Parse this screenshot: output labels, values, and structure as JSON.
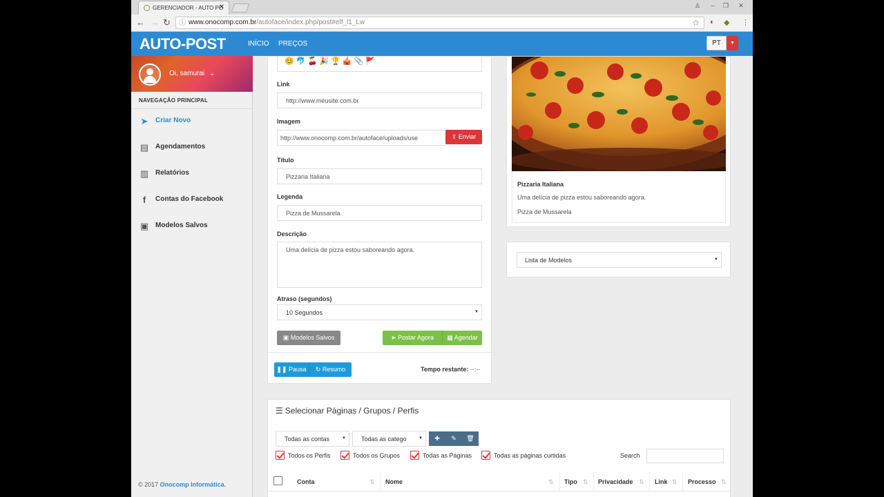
{
  "browser": {
    "tab_title": "GERENCIADOR - AUTO PO",
    "url_host": "www.onocomp.com.br",
    "url_path": "/autoface/index.php/post#elf_l1_Lw"
  },
  "app": {
    "brand": "AUTO-POST",
    "nav_links": [
      "INÍCIO",
      "PREÇOS"
    ],
    "language": "PT",
    "accent_color": "#2d8ad2",
    "danger_color": "#d9373b"
  },
  "sidebar": {
    "greeting": "Oi, samurai",
    "section_title": "NAVEGAÇÃO PRINCIPAL",
    "items": [
      {
        "label": "Criar Novo",
        "icon": "send-icon"
      },
      {
        "label": "Agendamentos",
        "icon": "clipboard-icon"
      },
      {
        "label": "Relatórios",
        "icon": "bar-chart-icon"
      },
      {
        "label": "Contas do Facebook",
        "icon": "facebook-icon"
      },
      {
        "label": "Modelos Salvos",
        "icon": "floppy-icon"
      }
    ],
    "copyright_prefix": "© 2017",
    "copyright_company": "Onocomp Informática."
  },
  "form": {
    "emoji_row": "😊 🐬 🍒 🎉 🏆 🎪 📎 🚩",
    "link_label": "Link",
    "link_placeholder": "http://www.meusite.com.br",
    "image_label": "Imagem",
    "image_value": "http://www.onocomp.com.br/autoface/uploads/use",
    "upload_button": "Enviar",
    "title_label": "Título",
    "title_value": "Pizzaria Italiana",
    "caption_label": "Legenda",
    "caption_value": "Pizza de Mussarela",
    "desc_label": "Descrição",
    "desc_value": "Uma delícia de pizza estou saboreando agora.",
    "delay_label": "Atraso (segundos)",
    "delay_value": "10 Segundos",
    "saved_models_button": "Modelos Salvos",
    "post_now_button": "Postar Agora",
    "schedule_button": "Agendar",
    "pause_button": "Pausa",
    "resume_button": "Resumo",
    "remaining_label": "Tempo restante:",
    "remaining_value": "--:--"
  },
  "preview": {
    "title": "Pizzaria Italiana",
    "description": "Uma delícia de pizza estou saboreando agora.",
    "caption": "Pizza de Mussarela"
  },
  "models": {
    "select_value": "Lista de Modelos"
  },
  "pages": {
    "title": "Selecionar Páginas / Grupos / Perfis",
    "accounts_filter": "Todas as contas",
    "category_filter": "Todas as catego",
    "checkboxes": [
      "Todos os Perfis",
      "Todos os Grupos",
      "Todas as Páginas",
      "Todas as páginas curtidas"
    ],
    "search_label": "Search",
    "columns": [
      "Conta",
      "Nome",
      "Tipo",
      "Privacidade",
      "Link",
      "Processo"
    ]
  }
}
